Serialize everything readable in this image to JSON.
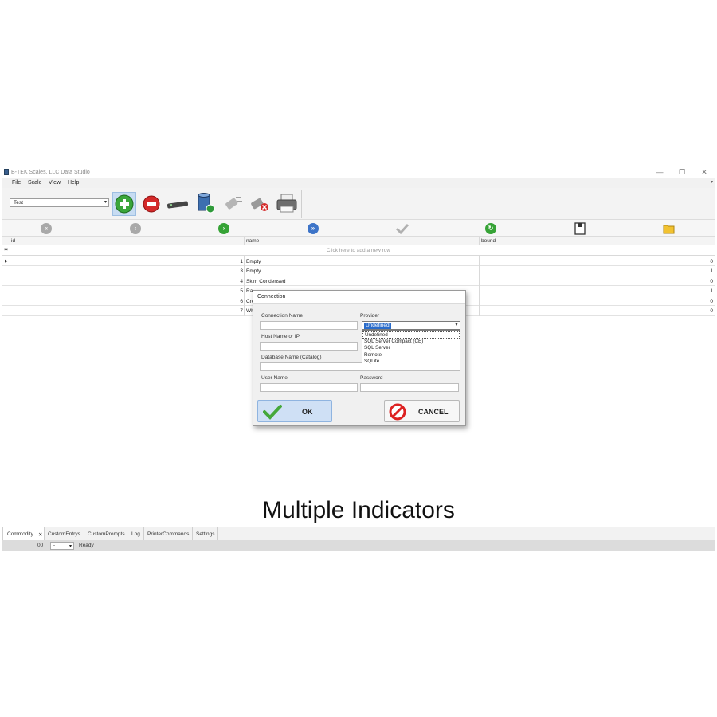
{
  "window": {
    "title": "B-TEK Scales, LLC Data Studio",
    "controls": [
      "—",
      "❐",
      "✕"
    ]
  },
  "menu": [
    "File",
    "Scale",
    "View",
    "Help"
  ],
  "toolbar": {
    "profile_value": "Test",
    "buttons": [
      "add-icon",
      "remove-icon",
      "scale-connect-icon",
      "database-sync-icon",
      "plug-icon",
      "plug-disconnect-icon",
      "printer-icon"
    ]
  },
  "nav": [
    "first-record-icon",
    "previous-record-icon",
    "next-record-icon",
    "last-record-icon",
    "apply-checkmark-icon",
    "refresh-icon",
    "save-disk-icon",
    "open-folder-icon"
  ],
  "grid": {
    "columns": [
      "id",
      "name",
      "bound"
    ],
    "new_row_text": "Click here to add a new row",
    "rows": [
      {
        "id": "1",
        "name": "Empty",
        "bound": "0"
      },
      {
        "id": "3",
        "name": "Empty",
        "bound": "1"
      },
      {
        "id": "4",
        "name": "Skim Condensed",
        "bound": "0"
      },
      {
        "id": "5",
        "name": "Ra",
        "bound": "1"
      },
      {
        "id": "6",
        "name": "Cre",
        "bound": "0"
      },
      {
        "id": "7",
        "name": "Wh",
        "bound": "0"
      }
    ]
  },
  "dialog": {
    "title": "Connection",
    "connection_name_label": "Connection Name",
    "provider_label": "Provider",
    "provider_value": "Undefined",
    "provider_options": [
      "Undefined",
      "SQL Server Compact (CE)",
      "SQL Server",
      "Remote",
      "SQLite"
    ],
    "host_label": "Host Name or IP",
    "database_label": "Database Name (Catalog)",
    "database_browse": "...",
    "user_label": "User Name",
    "password_label": "Password",
    "ok_label": "OK",
    "cancel_label": "CANCEL"
  },
  "caption": "Multiple Indicators",
  "tabs": [
    {
      "label": "Commodity",
      "close": "✕"
    },
    {
      "label": "CustomEntrys"
    },
    {
      "label": "CustomPrompts"
    },
    {
      "label": "Log"
    },
    {
      "label": "PrinterCommands"
    },
    {
      "label": "Settings"
    }
  ],
  "status": {
    "code": "00",
    "dropdown_value": "-",
    "text": "Ready"
  }
}
